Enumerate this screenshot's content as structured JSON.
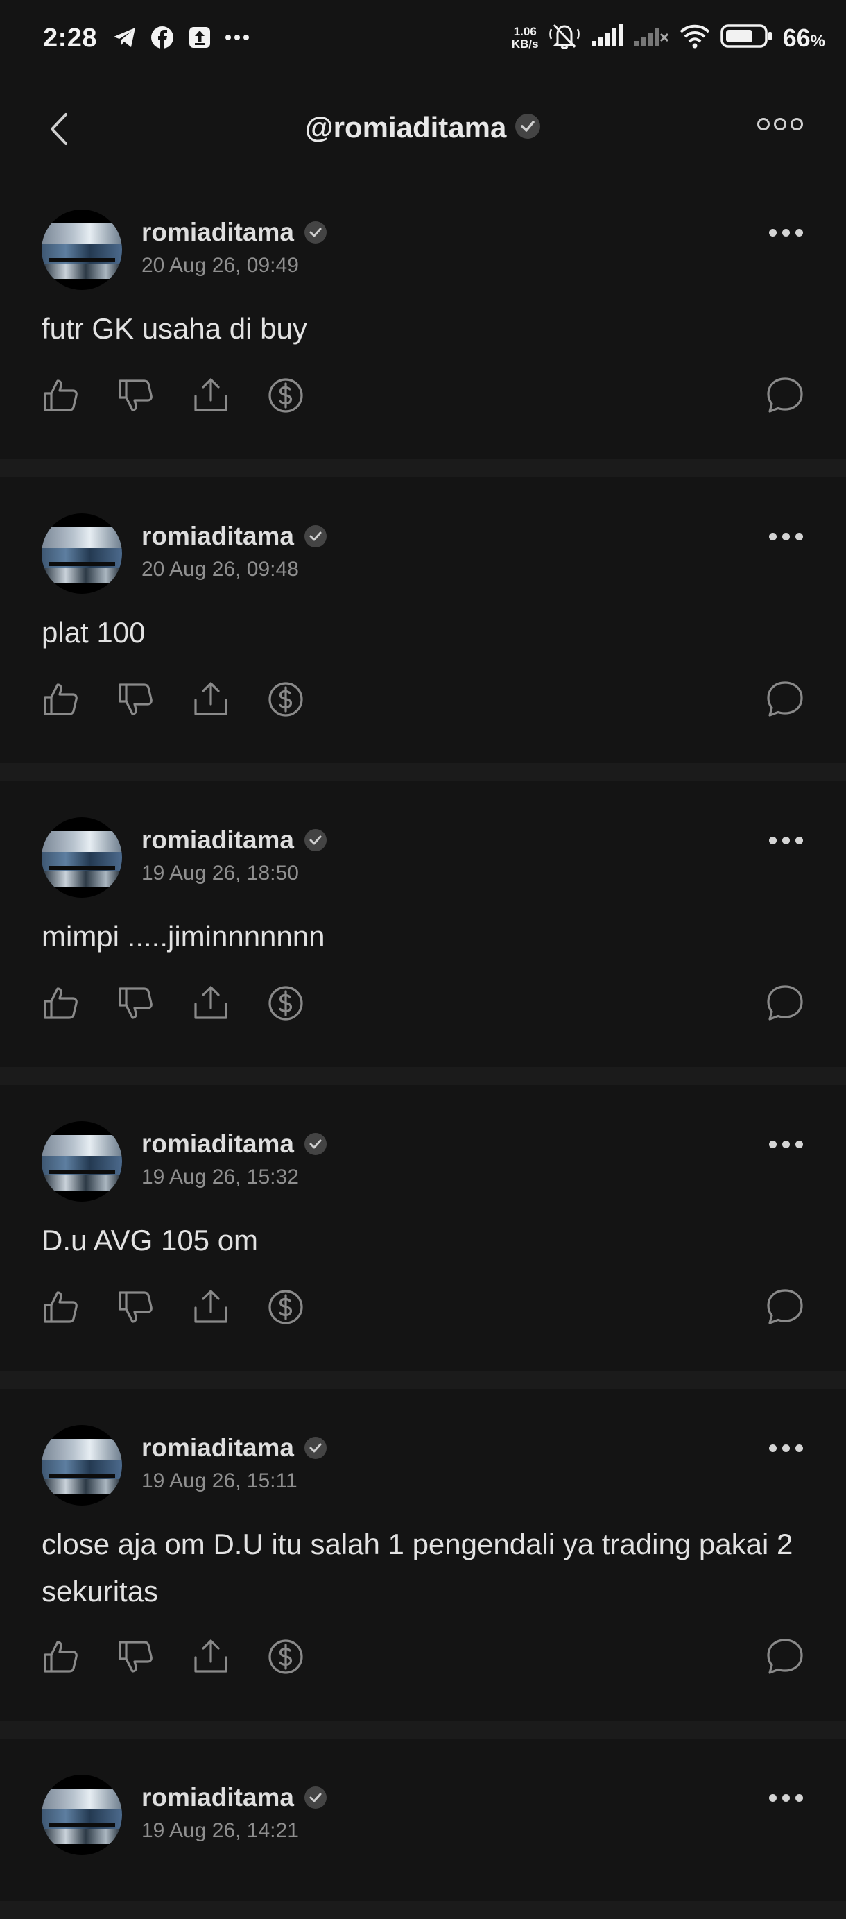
{
  "status_bar": {
    "time": "2:28",
    "net_speed_value": "1.06",
    "net_speed_unit": "KB/s",
    "battery_value": "66",
    "battery_unit": "%"
  },
  "header": {
    "title": "@romiaditama"
  },
  "posts": [
    {
      "username": "romiaditama",
      "timestamp": "20 Aug 26, 09:49",
      "body": "futr GK usaha di buy"
    },
    {
      "username": "romiaditama",
      "timestamp": "20 Aug 26, 09:48",
      "body": "plat 100"
    },
    {
      "username": "romiaditama",
      "timestamp": "19 Aug 26, 18:50",
      "body": "mimpi .....jiminnnnnnn"
    },
    {
      "username": "romiaditama",
      "timestamp": "19 Aug 26, 15:32",
      "body": "D.u AVG 105 om"
    },
    {
      "username": "romiaditama",
      "timestamp": "19 Aug 26, 15:11",
      "body": "close aja om D.U itu salah 1 pengendali ya trading pakai 2 sekuritas"
    },
    {
      "username": "romiaditama",
      "timestamp": "19 Aug 26, 14:21",
      "body": ""
    }
  ],
  "icons": {
    "status_left": [
      "telegram-icon",
      "facebook-icon",
      "upload-notification-icon",
      "more-notifications-icon"
    ],
    "status_right": [
      "mute-icon",
      "signal-icon",
      "signal-no-service-icon",
      "wifi-icon",
      "battery-icon"
    ],
    "post_actions": [
      "like-icon",
      "dislike-icon",
      "share-icon",
      "tip-icon",
      "comment-icon"
    ]
  },
  "colors": {
    "background": "#141414",
    "separator": "#1b1b1b",
    "text_primary": "#e2e2e2",
    "text_secondary": "#8f8f8f",
    "icon": "#8a8a8a"
  }
}
